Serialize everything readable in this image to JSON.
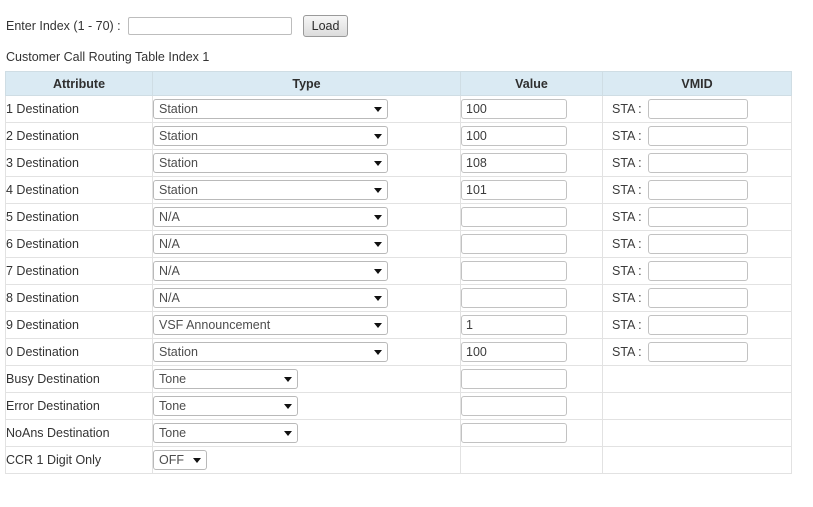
{
  "index_form": {
    "label": "Enter Index (1 - 70) :",
    "input_value": "",
    "input_placeholder": "",
    "load_label": "Load"
  },
  "table_caption": "Customer Call Routing Table Index 1",
  "table": {
    "headers": {
      "attribute": "Attribute",
      "type": "Type",
      "value": "Value",
      "vmid": "VMID"
    },
    "vmid_prefix": "STA :",
    "rows": [
      {
        "attribute": "1 Destination",
        "type": "Station",
        "value": "100",
        "vmid": "",
        "has_value": true,
        "has_vmid": true,
        "select_size": "wide"
      },
      {
        "attribute": "2 Destination",
        "type": "Station",
        "value": "100",
        "vmid": "",
        "has_value": true,
        "has_vmid": true,
        "select_size": "wide"
      },
      {
        "attribute": "3 Destination",
        "type": "Station",
        "value": "108",
        "vmid": "",
        "has_value": true,
        "has_vmid": true,
        "select_size": "wide"
      },
      {
        "attribute": "4 Destination",
        "type": "Station",
        "value": "101",
        "vmid": "",
        "has_value": true,
        "has_vmid": true,
        "select_size": "wide"
      },
      {
        "attribute": "5 Destination",
        "type": "N/A",
        "value": "",
        "vmid": "",
        "has_value": true,
        "has_vmid": true,
        "select_size": "wide"
      },
      {
        "attribute": "6 Destination",
        "type": "N/A",
        "value": "",
        "vmid": "",
        "has_value": true,
        "has_vmid": true,
        "select_size": "wide"
      },
      {
        "attribute": "7 Destination",
        "type": "N/A",
        "value": "",
        "vmid": "",
        "has_value": true,
        "has_vmid": true,
        "select_size": "wide"
      },
      {
        "attribute": "8 Destination",
        "type": "N/A",
        "value": "",
        "vmid": "",
        "has_value": true,
        "has_vmid": true,
        "select_size": "wide"
      },
      {
        "attribute": "9 Destination",
        "type": "VSF Announcement",
        "value": "1",
        "vmid": "",
        "has_value": true,
        "has_vmid": true,
        "select_size": "wide"
      },
      {
        "attribute": "0 Destination",
        "type": "Station",
        "value": "100",
        "vmid": "",
        "has_value": true,
        "has_vmid": true,
        "select_size": "wide"
      },
      {
        "attribute": "Busy Destination",
        "type": "Tone",
        "value": "",
        "vmid": "",
        "has_value": true,
        "has_vmid": false,
        "select_size": "medium"
      },
      {
        "attribute": "Error Destination",
        "type": "Tone",
        "value": "",
        "vmid": "",
        "has_value": true,
        "has_vmid": false,
        "select_size": "medium"
      },
      {
        "attribute": "NoAns Destination",
        "type": "Tone",
        "value": "",
        "vmid": "",
        "has_value": true,
        "has_vmid": false,
        "select_size": "medium"
      },
      {
        "attribute": "CCR 1 Digit Only",
        "type": "OFF",
        "value": "",
        "vmid": "",
        "has_value": false,
        "has_vmid": false,
        "select_size": "narrow"
      }
    ]
  },
  "colors": {
    "header_background": "#daeaf3",
    "header_text": "#2f2f2f",
    "border": "#e2e2e2",
    "page_background": "#ffffff"
  }
}
